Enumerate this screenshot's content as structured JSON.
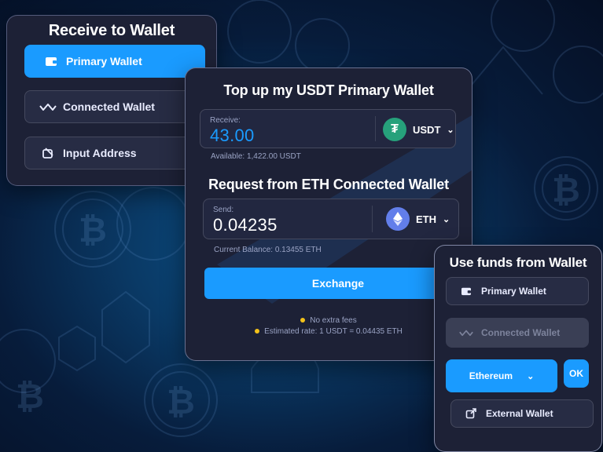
{
  "receive_card": {
    "title": "Receive to Wallet",
    "options": [
      {
        "label": "Primary Wallet",
        "icon": "wallet-icon"
      },
      {
        "label": "Connected Wallet",
        "icon": "walletconnect-icon"
      },
      {
        "label": "Input Address",
        "icon": "input-address-icon"
      }
    ]
  },
  "topup_card": {
    "title": "Top up my USDT Primary Wallet",
    "receive": {
      "label": "Receive:",
      "value": "43.00",
      "token": "USDT",
      "available": "Available: 1,422.00 USDT"
    },
    "request_title": "Request from ETH Connected Wallet",
    "send": {
      "label": "Send:",
      "value": "0.04235",
      "token": "ETH",
      "balance": "Current Balance: 0.13455 ETH"
    },
    "exchange_label": "Exchange",
    "notes": [
      "No extra fees",
      "Estimated rate: 1 USDT = 0.04435 ETH"
    ]
  },
  "funds_card": {
    "title": "Use funds from Wallet",
    "primary_label": "Primary Wallet",
    "connected_label": "Connected Wallet",
    "network_value": "Ethereum",
    "ok_label": "OK",
    "external_label": "External Wallet"
  },
  "colors": {
    "accent": "#1a9bff",
    "usdt": "#26a17b",
    "eth": "#627eea",
    "card": "#1d2136"
  }
}
